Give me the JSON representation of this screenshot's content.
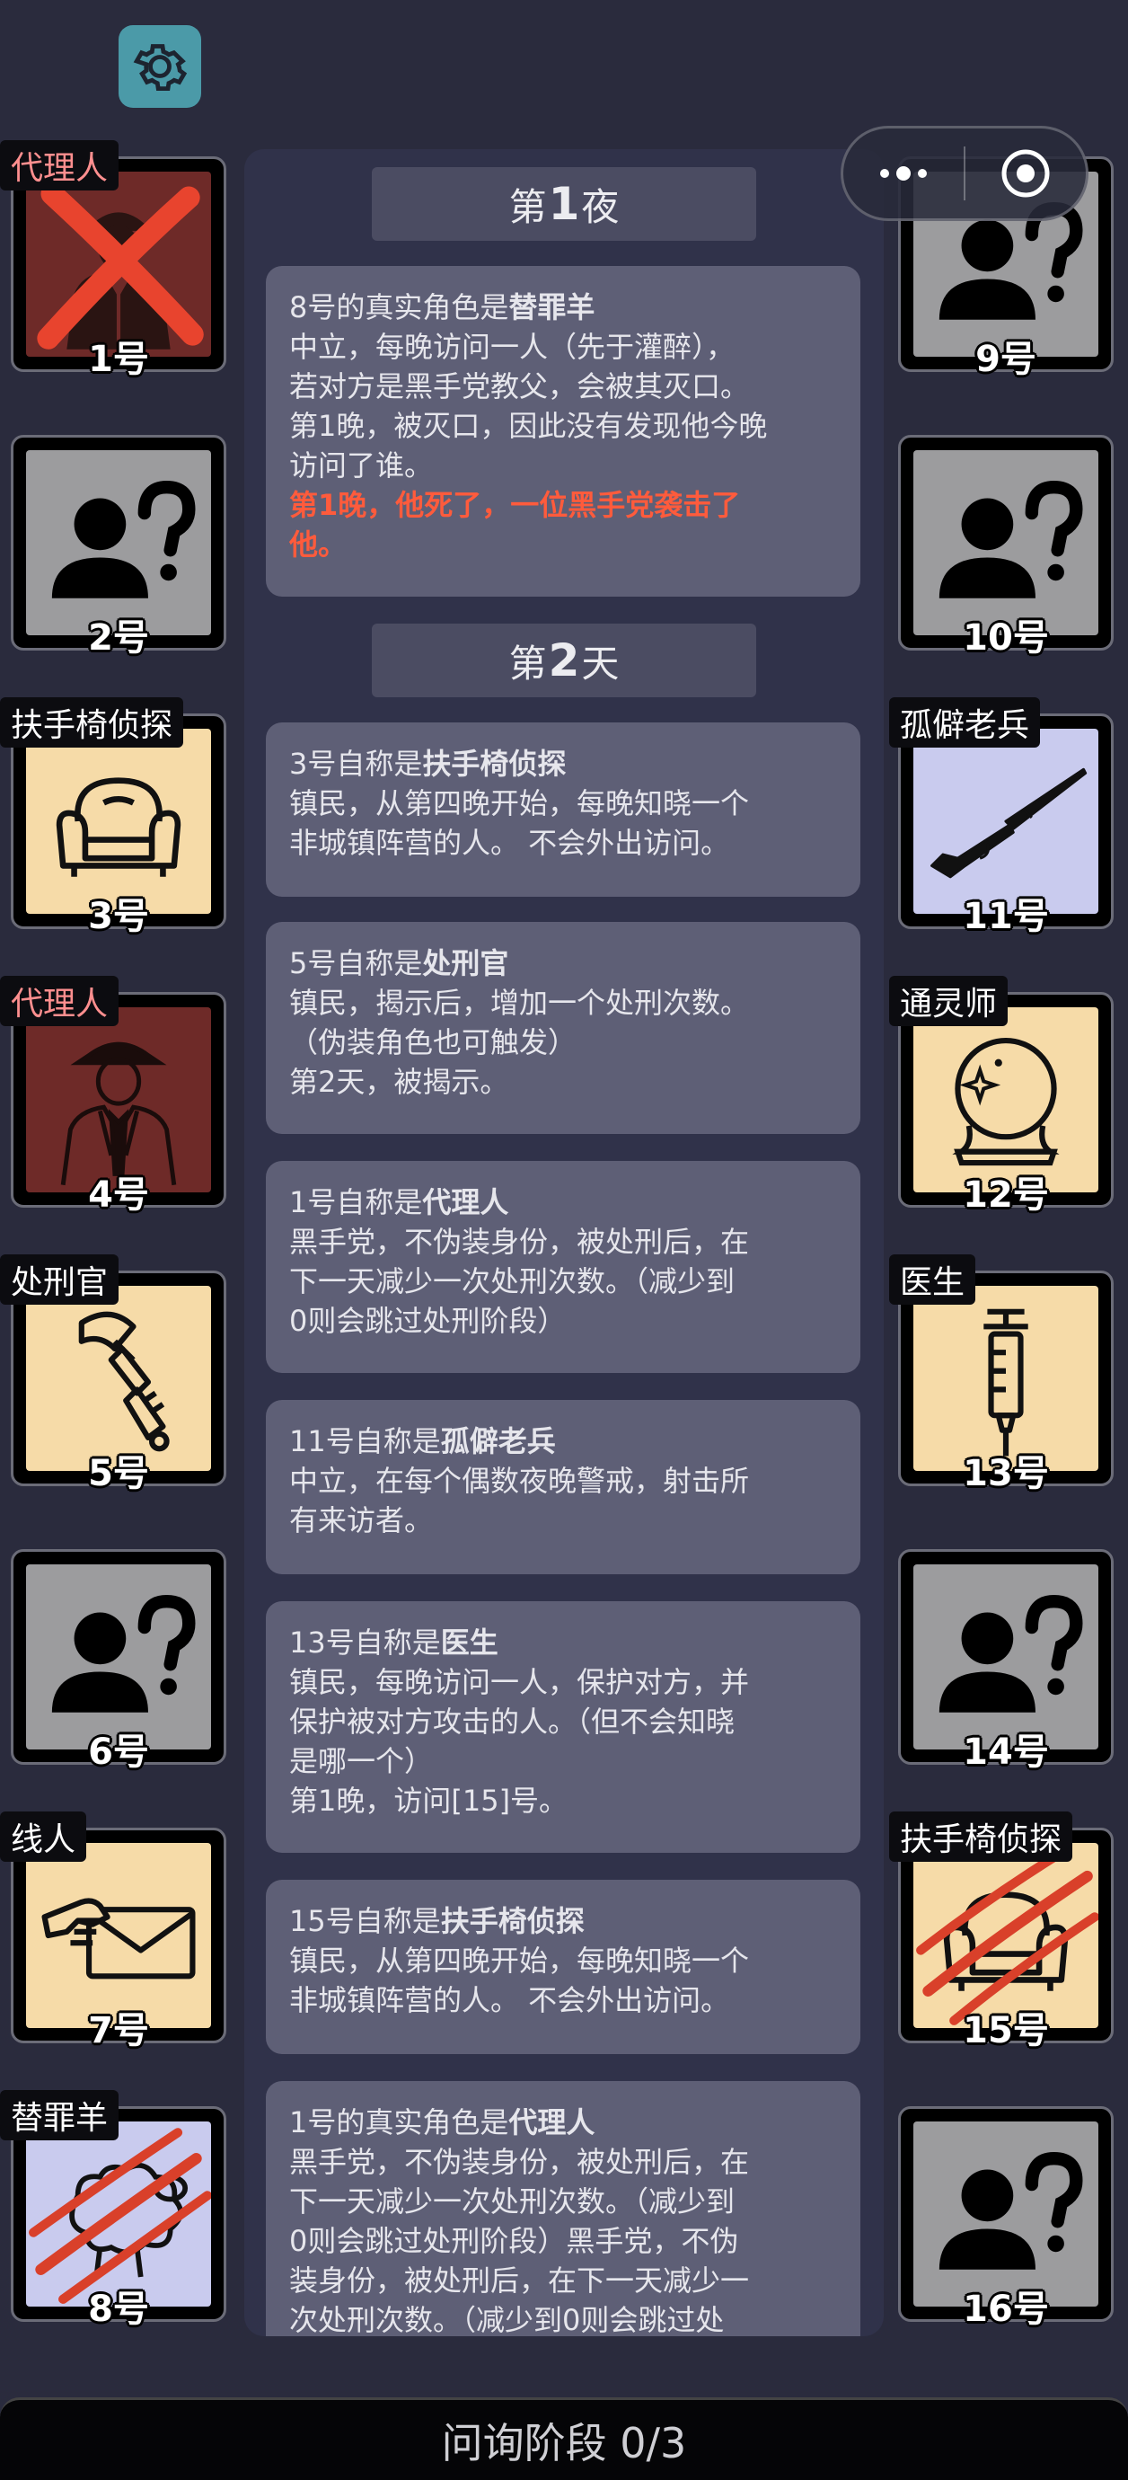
{
  "top": {
    "settings_icon": "gear-icon"
  },
  "capsule": {
    "more_icon": "dots-icon",
    "close_icon": "target-icon"
  },
  "headers": {
    "night1": {
      "prefix": "第",
      "num": "1",
      "suffix": "夜"
    },
    "day2": {
      "prefix": "第",
      "num": "2",
      "suffix": "天"
    }
  },
  "cards": [
    {
      "title_prefix": "8号的真实角色是",
      "title_role": "替罪羊",
      "lines": [
        "中立，每晚访问一人（先于灌醉），",
        "若对方是黑手党教父，会被其灭口。",
        "第1晚，被灭口，因此没有发现他今晚",
        "访问了谁。"
      ],
      "red_lines": [
        "第1晚，他死了，一位黑手党袭击了",
        "他。"
      ]
    },
    {
      "title_prefix": "3号自称是",
      "title_role": "扶手椅侦探",
      "lines": [
        "镇民，从第四晚开始，每晚知晓一个",
        "非城镇阵营的人。 不会外出访问。"
      ]
    },
    {
      "title_prefix": "5号自称是",
      "title_role": "处刑官",
      "lines": [
        "镇民，揭示后，增加一个处刑次数。",
        "（伪装角色也可触发）",
        "第2天，被揭示。"
      ]
    },
    {
      "title_prefix": "1号自称是",
      "title_role": "代理人",
      "lines": [
        "黑手党，不伪装身份，被处刑后，在",
        "下一天减少一次处刑次数。（减少到",
        "0则会跳过处刑阶段）"
      ]
    },
    {
      "title_prefix": "11号自称是",
      "title_role": "孤僻老兵",
      "lines": [
        "中立，在每个偶数夜晚警戒，射击所",
        "有来访者。"
      ]
    },
    {
      "title_prefix": "13号自称是",
      "title_role": "医生",
      "lines": [
        "镇民，每晚访问一人，保护对方，并",
        "保护被对方攻击的人。（但不会知晓",
        "是哪一个）",
        "第1晚，访问[15]号。"
      ]
    },
    {
      "title_prefix": "15号自称是",
      "title_role": "扶手椅侦探",
      "lines": [
        "镇民，从第四晚开始，每晚知晓一个",
        "非城镇阵营的人。 不会外出访问。"
      ]
    },
    {
      "title_prefix": "1号的真实角色是",
      "title_role": "代理人",
      "lines": [
        "黑手党，不伪装身份，被处刑后，在",
        "下一天减少一次处刑次数。（减少到",
        "0则会跳过处刑阶段）黑手党，不伪",
        "装身份，被处刑后，在下一天减少一",
        "次处刑次数。（减少到0则会跳过处"
      ]
    }
  ],
  "players": [
    {
      "num": "1号",
      "tag": "代理人",
      "icon": "agent-icon",
      "status": "eliminated"
    },
    {
      "num": "2号",
      "tag": "",
      "icon": "unknown-person-icon"
    },
    {
      "num": "3号",
      "tag": "扶手椅侦探",
      "icon": "armchair-icon"
    },
    {
      "num": "4号",
      "tag": "代理人",
      "icon": "agent-icon"
    },
    {
      "num": "5号",
      "tag": "处刑官",
      "icon": "axe-icon"
    },
    {
      "num": "6号",
      "tag": "",
      "icon": "unknown-person-icon"
    },
    {
      "num": "7号",
      "tag": "线人",
      "icon": "envelope-icon"
    },
    {
      "num": "8号",
      "tag": "替罪羊",
      "icon": "sheep-icon",
      "status": "attacked"
    },
    {
      "num": "9号",
      "tag": "",
      "icon": "unknown-person-icon"
    },
    {
      "num": "10号",
      "tag": "",
      "icon": "unknown-person-icon"
    },
    {
      "num": "11号",
      "tag": "孤僻老兵",
      "icon": "rifle-icon"
    },
    {
      "num": "12号",
      "tag": "通灵师",
      "icon": "crystal-ball-icon"
    },
    {
      "num": "13号",
      "tag": "医生",
      "icon": "syringe-icon"
    },
    {
      "num": "14号",
      "tag": "",
      "icon": "unknown-person-icon"
    },
    {
      "num": "15号",
      "tag": "扶手椅侦探",
      "icon": "armchair-icon",
      "status": "attacked"
    },
    {
      "num": "16号",
      "tag": "",
      "icon": "unknown-person-icon"
    }
  ],
  "bottom": {
    "label": "问询阶段 0/3"
  }
}
